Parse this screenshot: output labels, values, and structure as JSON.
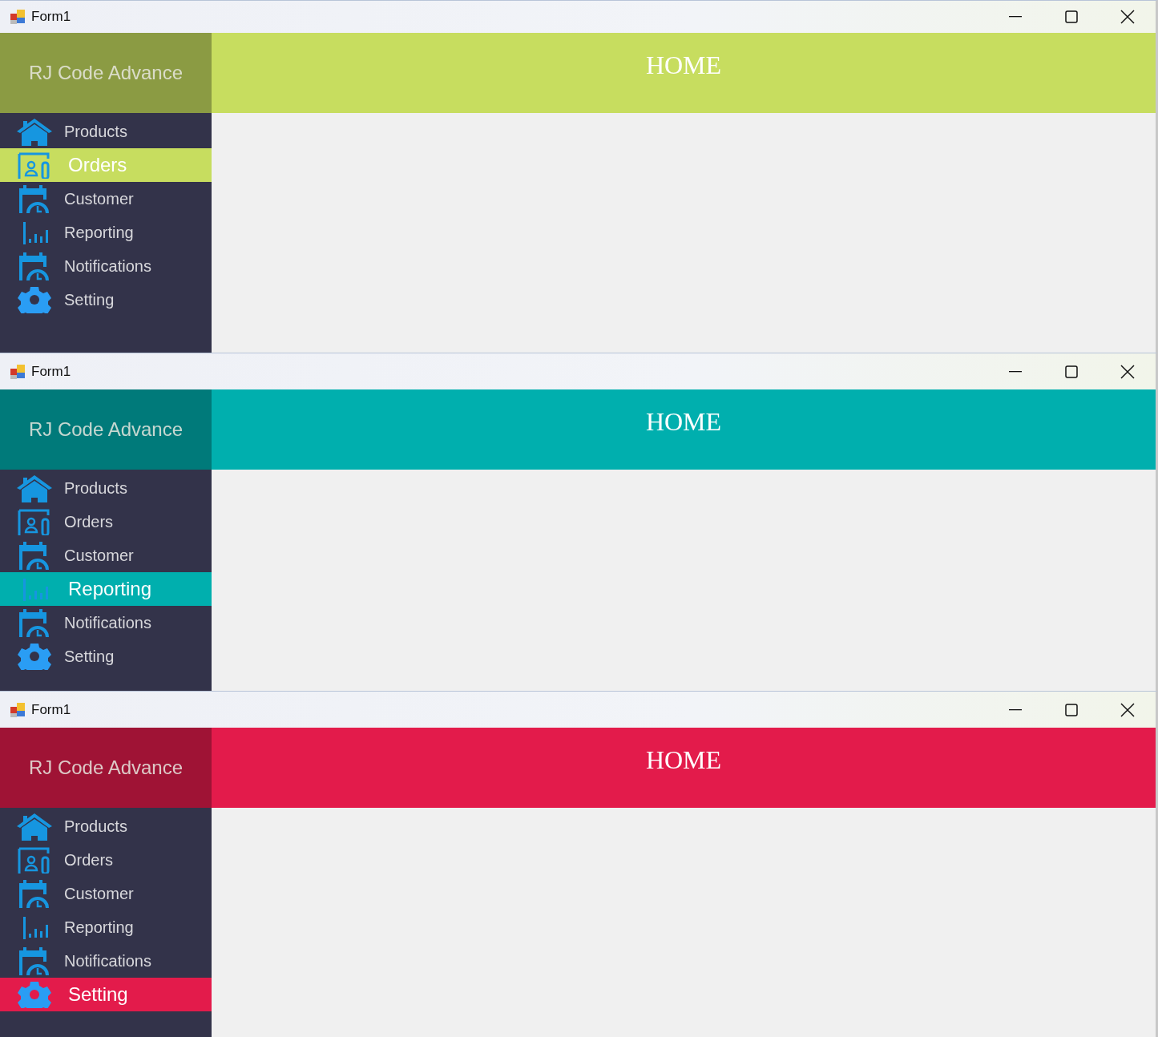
{
  "windows": [
    {
      "title": "Form1",
      "color": "#c7dd5f",
      "logo": "RJ Code Advance",
      "header": "HOME",
      "menu": [
        {
          "label": "Products",
          "selected": false
        },
        {
          "label": "Orders",
          "selected": true
        },
        {
          "label": "Customer",
          "selected": false
        },
        {
          "label": "Reporting",
          "selected": false
        },
        {
          "label": "Notifications",
          "selected": false
        },
        {
          "label": "Setting",
          "selected": false
        }
      ]
    },
    {
      "title": "Form1",
      "color": "#00afae",
      "logo": "RJ Code Advance",
      "header": "HOME",
      "menu": [
        {
          "label": "Products",
          "selected": false
        },
        {
          "label": "Orders",
          "selected": false
        },
        {
          "label": "Customer",
          "selected": false
        },
        {
          "label": "Reporting",
          "selected": true
        },
        {
          "label": "Notifications",
          "selected": false
        },
        {
          "label": "Setting",
          "selected": false
        }
      ]
    },
    {
      "title": "Form1",
      "color": "#e31b4b",
      "logo": "RJ Code Advance",
      "header": "HOME",
      "menu": [
        {
          "label": "Products",
          "selected": false
        },
        {
          "label": "Orders",
          "selected": false
        },
        {
          "label": "Customer",
          "selected": false
        },
        {
          "label": "Reporting",
          "selected": false
        },
        {
          "label": "Notifications",
          "selected": false
        },
        {
          "label": "Setting",
          "selected": true
        }
      ]
    }
  ]
}
